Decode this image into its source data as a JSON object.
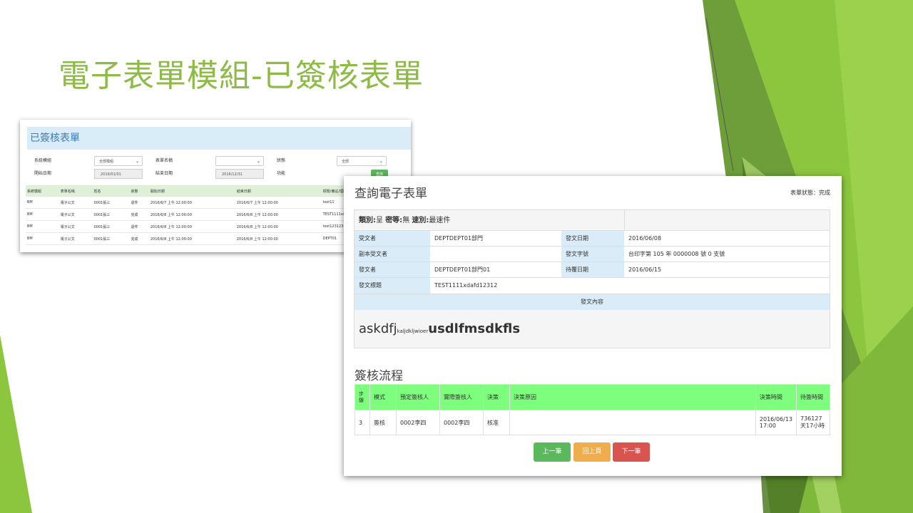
{
  "slide": {
    "title": "電子表單模組-已簽核表單"
  },
  "list_view": {
    "header": "已簽核表單",
    "filters": {
      "system_module_label": "系統模組",
      "system_module_value": "全部模組",
      "form_name_label": "表單名稱",
      "form_name_value": "",
      "status_label": "狀態",
      "status_value": "全部",
      "start_date_label": "開始日期",
      "start_date_value": "2016/01/01",
      "end_date_label": "結束日期",
      "end_date_value": "2016/12/31",
      "function_label": "功能",
      "query_button": "查詢"
    },
    "columns": [
      "系統模組",
      "表單名稱",
      "姓名",
      "狀態",
      "開始日期",
      "結束日期",
      "標題/備註/理由"
    ],
    "rows": [
      [
        "BM",
        "電子公文",
        "0001張三",
        "退件",
        "2016/6/7 上午 12:00:00",
        "2016/6/7 上午 12:00:00",
        "test11"
      ],
      [
        "BM",
        "電子公文",
        "0001張三",
        "完成",
        "2016/6/8 上午 12:00:00",
        "2016/6/8 上午 12:00:00",
        "TEST1111xdafd12312"
      ],
      [
        "BM",
        "電子公文",
        "0001張三",
        "退件",
        "2016/6/8 上午 12:00:00",
        "2016/6/8 上午 12:00:00",
        "test123123"
      ],
      [
        "BM",
        "電子公文",
        "0001張三",
        "完成",
        "2016/6/8 上午 12:00:00",
        "2016/6/8 上午 12:00:00",
        "DEPT01"
      ]
    ]
  },
  "detail_view": {
    "title": "查詢電子表單",
    "status": "表單狀態：完成",
    "type_line": {
      "category_label": "類別:",
      "category_value": "呈",
      "secret_label": "密等:",
      "secret_value": "無",
      "speed_label": "速別:",
      "speed_value": "最速件"
    },
    "fields": {
      "recipient_label": "受文者",
      "recipient_value": "DEPTDEPT01部門",
      "send_date_label": "發文日期",
      "send_date_value": "2016/06/08",
      "cc_label": "副本受文者",
      "cc_value": "",
      "doc_no_label": "發文字號",
      "doc_no_value": "台印字第 105 年 0000008 號 0 支號",
      "sender_label": "發文者",
      "sender_value": "DEPTDEPT01部門01",
      "due_date_label": "待覆日期",
      "due_date_value": "2016/06/15",
      "subject_label": "發文標題",
      "subject_value": "TEST1111xdafd12312"
    },
    "content_label": "發文內容",
    "content": {
      "part1": "askdfj",
      "part2": "kaljdkljwioer",
      "part3": "usdlfmsdkfls"
    },
    "flow": {
      "title": "簽核流程",
      "columns": [
        "步驟",
        "模式",
        "預定簽核人",
        "實際簽核人",
        "決策",
        "決策原因",
        "決策時間",
        "待簽時間"
      ],
      "rows": [
        [
          "3",
          "簽核",
          "0002李四",
          "0002李四",
          "核准",
          "",
          "2016/06/13 17:00",
          "736127天17小時"
        ]
      ]
    },
    "buttons": {
      "prev": "上一筆",
      "back": "回上頁",
      "next": "下一筆"
    },
    "colors": {
      "prev": "#5cb85c",
      "back": "#f0ad4e",
      "next": "#d9534f",
      "flow_header": "#7dff7d"
    }
  }
}
